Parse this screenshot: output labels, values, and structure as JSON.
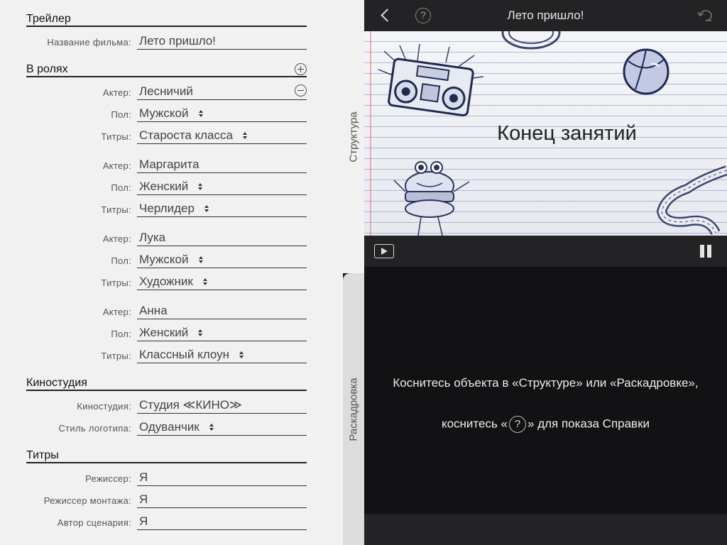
{
  "form": {
    "trailer": {
      "header": "Трейлер",
      "title_label": "Название фильма:",
      "title_value": "Лето пришло!"
    },
    "cast": {
      "header": "В ролях",
      "actor_label": "Актер:",
      "gender_label": "Пол:",
      "credits_label": "Титры:",
      "members": [
        {
          "actor": "Лесничий",
          "gender": "Мужской",
          "credit": "Староста класса"
        },
        {
          "actor": "Маргарита",
          "gender": "Женский",
          "credit": "Черлидер"
        },
        {
          "actor": "Лука",
          "gender": "Мужской",
          "credit": "Художник"
        },
        {
          "actor": "Анна",
          "gender": "Женский",
          "credit": "Классный клоун"
        }
      ]
    },
    "studio": {
      "header": "Киностудия",
      "studio_label": "Киностудия:",
      "studio_value": "Студия ≪КИНО≫",
      "logo_label": "Стиль логотипа:",
      "logo_value": "Одуванчик"
    },
    "credits": {
      "header": "Титры",
      "director_label": "Режиссер:",
      "director_value": "Я",
      "editor_label": "Режиссер монтажа:",
      "editor_value": "Я",
      "writer_label": "Автор сценария:",
      "writer_value": "Я"
    }
  },
  "tabs": {
    "structure": "Структура",
    "storyboard": "Раскадровка"
  },
  "top_bar": {
    "title": "Лето пришло!",
    "help_glyph": "?"
  },
  "preview": {
    "caption": "Конец занятий"
  },
  "storyboard": {
    "hint_line_1": "Коснитесь объекта в «Структуре» или «Раскадровке»,",
    "hint_line_2_before": "коснитесь «",
    "hint_line_2_glyph": "?",
    "hint_line_2_after": "» для показа Справки"
  },
  "colors": {
    "form_background": "#f1f1f1",
    "dark_background": "#121214",
    "bar_background": "#232325"
  }
}
